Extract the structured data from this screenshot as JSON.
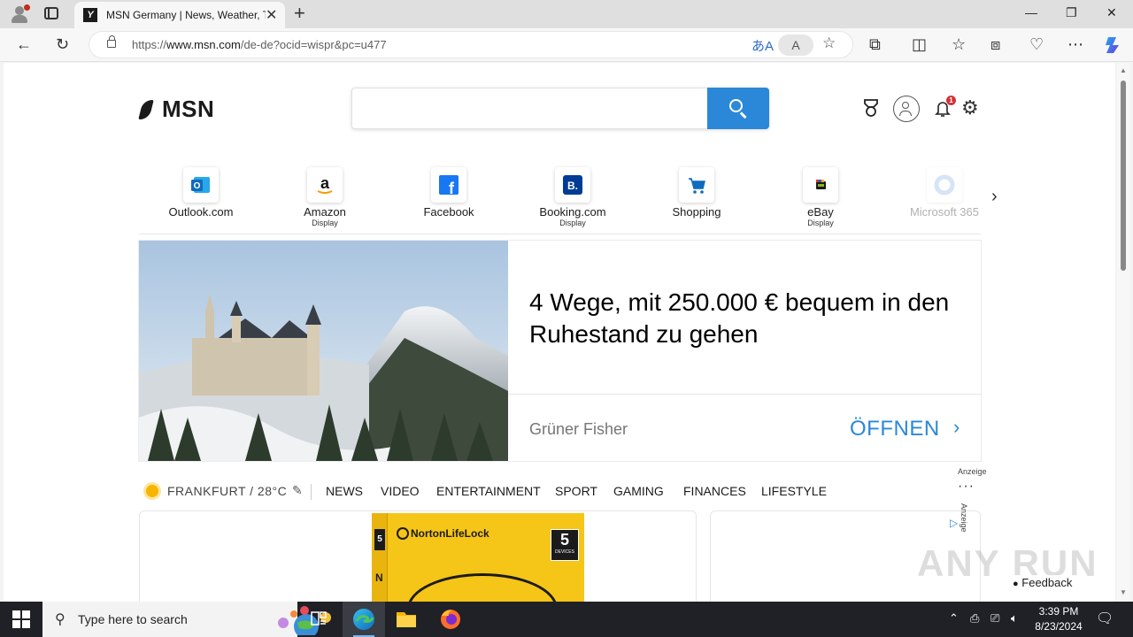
{
  "browser": {
    "tab_title": "MSN Germany | News, Weather, Top Stories",
    "tab_favicon_letter": "Y",
    "url_prefix": "https://",
    "url_host": "www.msn.com",
    "url_path": "/de-de?ocid=wispr&pc=u477",
    "translate_glyph": "あA",
    "read_aloud_glyph": "A"
  },
  "msn": {
    "logo_text": "MSN",
    "search_value": "",
    "notification_count": "1"
  },
  "quick_links": [
    {
      "label": "Outlook.com",
      "sub": "",
      "icon": "outlook-icon",
      "color": "#0f6cbd"
    },
    {
      "label": "Amazon",
      "sub": "Display",
      "icon": "amazon-icon",
      "color": "#1b1b1b"
    },
    {
      "label": "Facebook",
      "sub": "",
      "icon": "facebook-icon",
      "color": "#1877f2"
    },
    {
      "label": "Booking.com",
      "sub": "Display",
      "icon": "booking-icon",
      "color": "#003b95"
    },
    {
      "label": "Shopping",
      "sub": "",
      "icon": "shopping-cart-icon",
      "color": "#0f6cbd"
    },
    {
      "label": "eBay",
      "sub": "Display",
      "icon": "ebay-icon",
      "color": "#e53238"
    },
    {
      "label": "Microsoft 365",
      "sub": "",
      "icon": "microsoft365-icon",
      "color": "#8fb4e8"
    }
  ],
  "ad": {
    "title": "4 Wege, mit 250.000 € bequem in den Ruhestand zu gehen",
    "sponsor": "Grüner Fisher",
    "cta": "ÖFFNEN",
    "label": "Anzeige"
  },
  "nav": {
    "weather_city": "FRANKFURT / 28°C",
    "items": [
      "NEWS",
      "VIDEO",
      "ENTERTAINMENT",
      "SPORT",
      "GAMING",
      "FINANCES",
      "LIFESTYLE"
    ],
    "more": "···"
  },
  "cards": {
    "norton_brand": "NortonLifeLock",
    "norton_devices_number": "5",
    "norton_devices_label": "DEVICES",
    "norton_side_letter": "N",
    "ad_label": "Anzeige"
  },
  "feedback_label": "Feedback",
  "watermark_text": "ANY RUN",
  "taskbar": {
    "search_placeholder": "Type here to search",
    "time": "3:39 PM",
    "date": "8/23/2024"
  },
  "colors": {
    "msn_blue": "#2b88d8",
    "taskbar": "#1f2126",
    "norton_yellow": "#f5c518"
  }
}
